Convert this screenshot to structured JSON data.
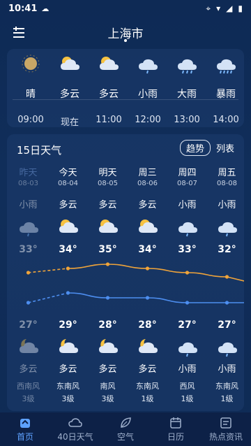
{
  "status": {
    "time": "10:41"
  },
  "header": {
    "city": "上海市"
  },
  "hourly": [
    {
      "cond": "晴",
      "time": "09:00",
      "icon": "moon-icon"
    },
    {
      "cond": "多云",
      "time": "现在",
      "icon": "partly-cloudy-icon"
    },
    {
      "cond": "多云",
      "time": "11:00",
      "icon": "partly-cloudy-icon"
    },
    {
      "cond": "小雨",
      "time": "12:00",
      "icon": "light-rain-icon"
    },
    {
      "cond": "大雨",
      "time": "13:00",
      "icon": "heavy-rain-icon"
    },
    {
      "cond": "暴雨",
      "time": "14:00",
      "icon": "storm-rain-icon"
    }
  ],
  "forecast": {
    "title": "15日天气",
    "toggle_trend": "趋势",
    "toggle_list": "列表",
    "days": [
      {
        "day": "昨天",
        "date": "08-03",
        "cond_day": "小雨",
        "hi": "33°",
        "lo": "27°",
        "cond_night": "多云",
        "wind": "西南风",
        "lvl": "3级",
        "icon_day": "light-rain-icon",
        "icon_night": "partly-cloudy-night-icon"
      },
      {
        "day": "今天",
        "date": "08-04",
        "cond_day": "多云",
        "hi": "34°",
        "lo": "29°",
        "cond_night": "多云",
        "wind": "东南风",
        "lvl": "3级",
        "icon_day": "partly-cloudy-icon",
        "icon_night": "partly-cloudy-night-icon"
      },
      {
        "day": "明天",
        "date": "08-05",
        "cond_day": "多云",
        "hi": "35°",
        "lo": "28°",
        "cond_night": "多云",
        "wind": "南风",
        "lvl": "3级",
        "icon_day": "partly-cloudy-icon",
        "icon_night": "partly-cloudy-night-icon"
      },
      {
        "day": "周三",
        "date": "08-06",
        "cond_day": "多云",
        "hi": "34°",
        "lo": "28°",
        "cond_night": "多云",
        "wind": "东南风",
        "lvl": "1级",
        "icon_day": "partly-cloudy-icon",
        "icon_night": "partly-cloudy-night-icon"
      },
      {
        "day": "周四",
        "date": "08-07",
        "cond_day": "小雨",
        "hi": "33°",
        "lo": "27°",
        "cond_night": "小雨",
        "wind": "西风",
        "lvl": "1级",
        "icon_day": "light-rain-icon",
        "icon_night": "light-rain-icon"
      },
      {
        "day": "周五",
        "date": "08-08",
        "cond_day": "小雨",
        "hi": "32°",
        "lo": "27°",
        "cond_night": "小雨",
        "wind": "东南风",
        "lvl": "1级",
        "icon_day": "light-rain-icon",
        "icon_night": "light-rain-icon"
      }
    ]
  },
  "chart_data": {
    "type": "line",
    "x": [
      "08-03",
      "08-04",
      "08-05",
      "08-06",
      "08-07",
      "08-08"
    ],
    "series": [
      {
        "values": [
          33,
          34,
          35,
          34,
          33,
          32
        ],
        "color": "#f0a43a"
      },
      {
        "values": [
          27,
          29,
          28,
          28,
          27,
          27
        ],
        "color": "#4d8ef0"
      }
    ]
  },
  "tabs": [
    {
      "label": "首页",
      "icon": "home-icon",
      "active": true
    },
    {
      "label": "40日天气",
      "icon": "cloud-icon",
      "active": false
    },
    {
      "label": "空气",
      "icon": "leaf-icon",
      "active": false
    },
    {
      "label": "日历",
      "icon": "calendar-icon",
      "active": false
    },
    {
      "label": "热点资讯",
      "icon": "news-icon",
      "active": false
    }
  ]
}
